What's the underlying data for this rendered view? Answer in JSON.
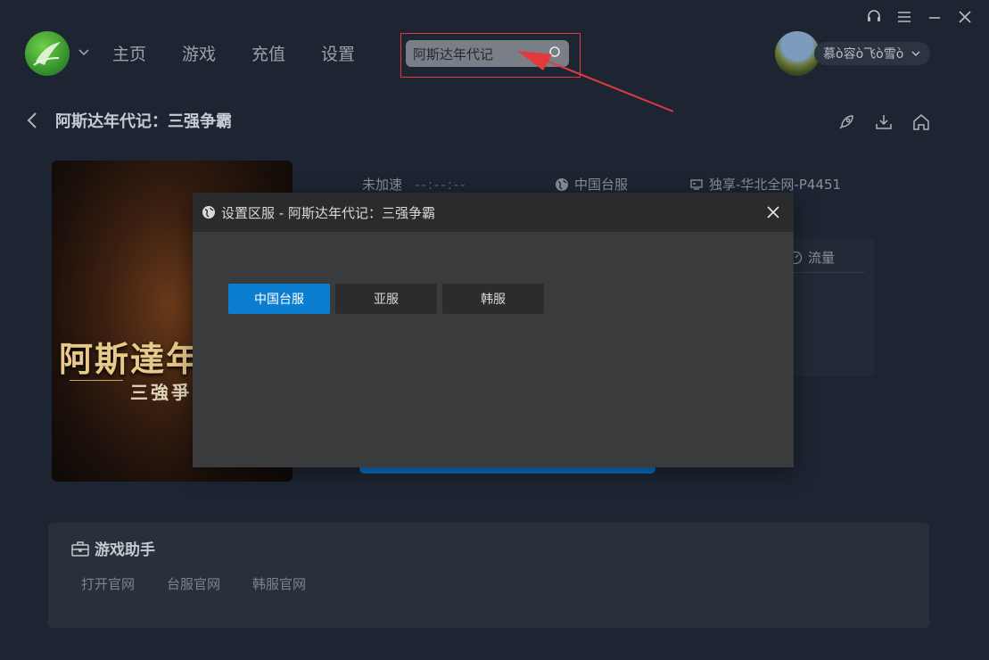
{
  "nav": {
    "items": [
      "主页",
      "游戏",
      "充值",
      "设置"
    ]
  },
  "search": {
    "value": "阿斯达年代记"
  },
  "user": {
    "name": "慕ò容ò飞ò雪ò"
  },
  "page": {
    "title": "阿斯达年代记：三强争霸"
  },
  "cover": {
    "title": "阿斯達年",
    "subtitle": "三強爭"
  },
  "info": {
    "status": "未加速",
    "timer": "--:--:--",
    "region": "中国台服",
    "node": "独享-华北全网-P4451",
    "traffic": "流量"
  },
  "assistant": {
    "title": "游戏助手",
    "links": [
      "打开官网",
      "台服官网",
      "韩服官网"
    ]
  },
  "modal": {
    "title": "设置区服  - 阿斯达年代记：三强争霸",
    "regions": [
      "中国台服",
      "亚服",
      "韩服"
    ],
    "selected": "中国台服"
  },
  "colors": {
    "accent": "#0b7ed0",
    "annotation": "#e3393c"
  }
}
